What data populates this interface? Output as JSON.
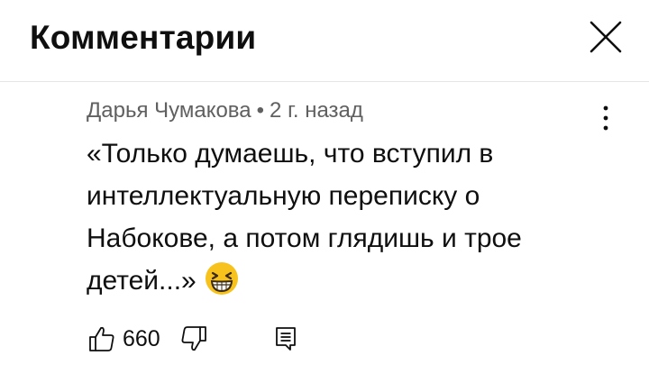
{
  "header": {
    "title": "Комментарии",
    "close_icon": "close-icon"
  },
  "comment": {
    "author": "Дарья Чумакова",
    "separator": "•",
    "time": "2 г. назад",
    "text": "«Только думаешь, что вступил в интеллектуальную переписку о Набокове, а потом глядишь и трое детей...»",
    "emoji": "grinning-squinting-face-emoji",
    "more_icon": "more-vertical-icon"
  },
  "actions": {
    "like_icon": "thumb-up-icon",
    "like_count": "660",
    "dislike_icon": "thumb-down-icon",
    "reply_icon": "reply-icon"
  },
  "colors": {
    "text": "#0f0f0f",
    "secondary_text": "#606060",
    "divider": "#e5e5e5",
    "emoji_yellow": "#f7c21b"
  }
}
